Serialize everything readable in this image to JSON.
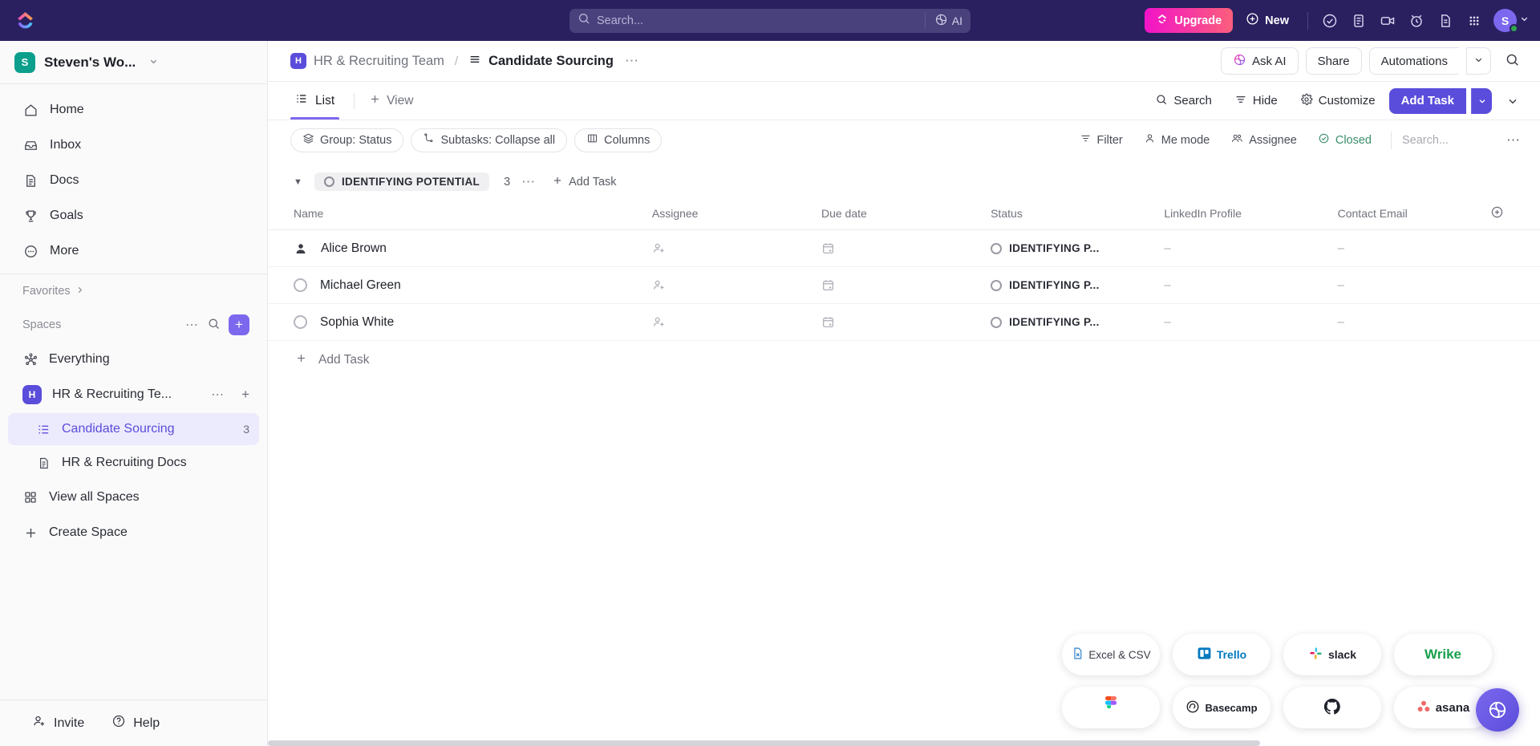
{
  "topbar": {
    "logo": "clickup-logo",
    "search": {
      "placeholder": "Search...",
      "ai_label": "AI",
      "ai_icon": "ai-sparkle-icon"
    },
    "upgrade_label": "Upgrade",
    "new_label": "New",
    "icons": [
      "checkmark-circle-icon",
      "clipboard-icon",
      "video-camera-icon",
      "alarm-clock-icon",
      "document-icon",
      "apps-grid-icon"
    ],
    "avatar_initial": "S"
  },
  "sidebar": {
    "workspace": {
      "initial": "S",
      "name": "Steven's Wo..."
    },
    "nav": [
      {
        "label": "Home",
        "icon": "home-icon"
      },
      {
        "label": "Inbox",
        "icon": "inbox-icon"
      },
      {
        "label": "Docs",
        "icon": "docs-icon"
      },
      {
        "label": "Goals",
        "icon": "trophy-icon"
      },
      {
        "label": "More",
        "icon": "more-dots-icon"
      }
    ],
    "favorites_label": "Favorites",
    "spaces_label": "Spaces",
    "everything_label": "Everything",
    "space": {
      "initial": "H",
      "name": "HR & Recruiting Te..."
    },
    "lists": [
      {
        "label": "Candidate Sourcing",
        "count": "3",
        "icon": "list-icon",
        "active": true
      },
      {
        "label": "HR & Recruiting Docs",
        "count": "",
        "icon": "doc-icon",
        "active": false
      }
    ],
    "view_all_spaces": "View all Spaces",
    "create_space": "Create Space",
    "footer": {
      "invite": "Invite",
      "help": "Help"
    }
  },
  "header": {
    "breadcrumb_space_initial": "H",
    "breadcrumb_space": "HR & Recruiting Team",
    "breadcrumb_separator": "/",
    "breadcrumb_current": "Candidate Sourcing",
    "ask_ai": "Ask AI",
    "share": "Share",
    "automations": "Automations",
    "search_icon": "search-icon"
  },
  "viewbar": {
    "tabs": [
      {
        "label": "List",
        "icon": "list-icon",
        "active": true
      }
    ],
    "add_view": "View",
    "actions": [
      {
        "label": "Search",
        "icon": "search-icon"
      },
      {
        "label": "Hide",
        "icon": "hide-icon"
      },
      {
        "label": "Customize",
        "icon": "gear-icon"
      }
    ],
    "add_task": "Add Task"
  },
  "filterbar": {
    "pills": [
      {
        "label": "Group: Status",
        "icon": "layers-icon"
      },
      {
        "label": "Subtasks: Collapse all",
        "icon": "subtask-icon"
      },
      {
        "label": "Columns",
        "icon": "columns-icon"
      }
    ],
    "right": [
      {
        "label": "Filter",
        "icon": "filter-icon"
      },
      {
        "label": "Me mode",
        "icon": "person-icon"
      },
      {
        "label": "Assignee",
        "icon": "assignee-icon"
      },
      {
        "label": "Closed",
        "icon": "closed-check-icon"
      }
    ],
    "search_placeholder": "Search...",
    "search_value": ""
  },
  "group": {
    "status_label": "IDENTIFYING POTENTIAL",
    "count": "3",
    "add_task": "Add Task"
  },
  "table": {
    "columns": [
      "Name",
      "Assignee",
      "Due date",
      "Status",
      "LinkedIn Profile",
      "Contact Email"
    ],
    "rows": [
      {
        "name": "Alice Brown",
        "assignee": "",
        "due_date": "",
        "status": "IDENTIFYING P...",
        "linkedin": "–",
        "email": "–"
      },
      {
        "name": "Michael Green",
        "assignee": "",
        "due_date": "",
        "status": "IDENTIFYING P...",
        "linkedin": "–",
        "email": "–"
      },
      {
        "name": "Sophia White",
        "assignee": "",
        "due_date": "",
        "status": "IDENTIFYING P...",
        "linkedin": "–",
        "email": "–"
      }
    ],
    "add_task_row": "Add Task"
  },
  "integrations": [
    {
      "label": "Excel & CSV",
      "icon": "excel-icon"
    },
    {
      "label": "Trello",
      "icon": "trello-icon"
    },
    {
      "label": "slack",
      "icon": "slack-icon"
    },
    {
      "label": "Wrike",
      "icon": "wrike-icon"
    },
    {
      "label": "",
      "icon": "figma-icon"
    },
    {
      "label": "Basecamp",
      "icon": "basecamp-icon"
    },
    {
      "label": "",
      "icon": "github-icon"
    },
    {
      "label": "asana",
      "icon": "asana-icon"
    }
  ],
  "colors": {
    "topbar_bg": "#2a2060",
    "accent_purple": "#7b68ee",
    "primary_button": "#5b4ddb",
    "upgrade_gradient_start": "#f213c8",
    "upgrade_gradient_end": "#fb5f7c",
    "workspace_badge": "#0b9f8c",
    "closed_green": "#3a8f6b"
  }
}
